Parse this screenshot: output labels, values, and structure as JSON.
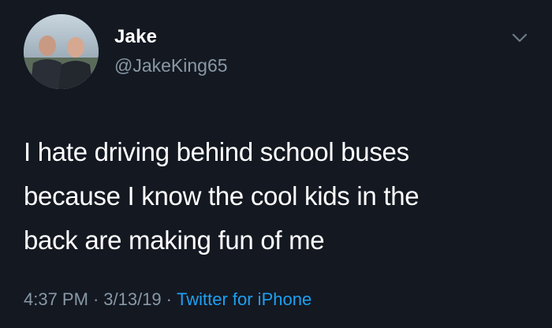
{
  "user": {
    "display_name": "Jake",
    "handle": "@JakeKing65"
  },
  "tweet": {
    "text_lines": [
      "I hate driving behind school buses",
      "because I know the cool kids in the",
      "back are making fun of me"
    ]
  },
  "meta": {
    "time": "4:37 PM",
    "separator": "·",
    "date": "3/13/19",
    "source": "Twitter for iPhone"
  },
  "colors": {
    "background": "#141821",
    "secondary_text": "#8899a6",
    "link": "#1da1f2"
  },
  "icons": {
    "menu": "chevron-down-icon"
  }
}
